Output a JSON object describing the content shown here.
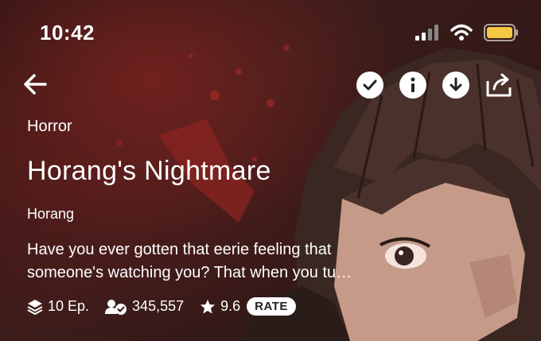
{
  "status_bar": {
    "time": "10:42"
  },
  "series": {
    "genre": "Horror",
    "title": "Horang's Nightmare",
    "author": "Horang",
    "description_line1": "Have you ever gotten that eerie feeling that",
    "description_line2": "someone's watching you? That when you tu…"
  },
  "stats": {
    "episodes": "10 Ep.",
    "subscribers": "345,557",
    "rating": "9.6",
    "rate_label": "RATE"
  },
  "icons": {
    "back": "arrow-left-icon",
    "subscribed": "checkmark-icon",
    "info": "info-icon",
    "download": "download-icon",
    "share": "share-icon"
  },
  "colors": {
    "battery": "#F5C842",
    "accent_bg": "#2d1514"
  }
}
